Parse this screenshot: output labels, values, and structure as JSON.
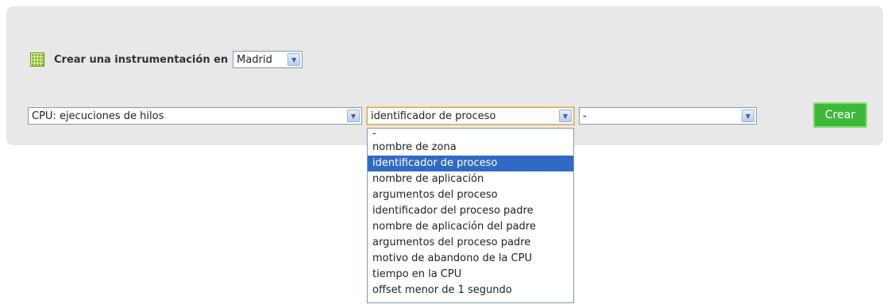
{
  "header": {
    "title": "Crear una instrumentación en",
    "city": "Madrid"
  },
  "controls": {
    "metric": "CPU: ejecuciones de hilos",
    "aggregation": "identificador de proceso",
    "third": "-",
    "create_label": "Crear"
  },
  "dropdown": {
    "options": [
      "-",
      "nombre de zona",
      "identificador de proceso",
      "nombre de aplicación",
      "argumentos del proceso",
      "identificador del proceso padre",
      "nombre de aplicación del padre",
      "argumentos del proceso padre",
      "motivo de abandono de la CPU",
      "tiempo en la CPU",
      "offset menor de 1 segundo"
    ],
    "selected": "identificador de proceso"
  },
  "colors": {
    "accent": "#3fb83a",
    "highlight": "#316ac5",
    "panel": "#e8e8e8"
  }
}
